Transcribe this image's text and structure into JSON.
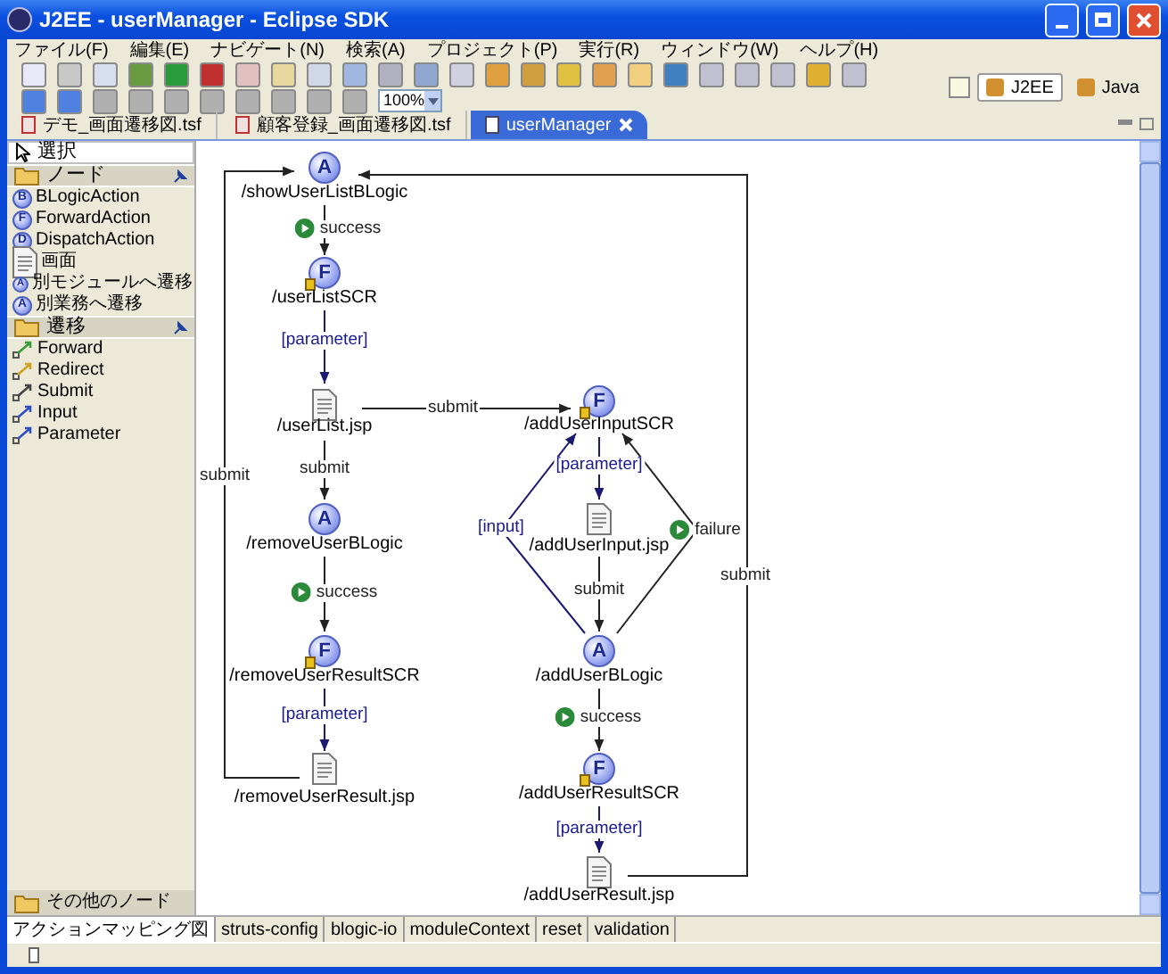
{
  "window": {
    "title": "J2EE - userManager - Eclipse SDK"
  },
  "menu": [
    "ファイル(F)",
    "編集(E)",
    "ナビゲート(N)",
    "検索(A)",
    "プロジェクト(P)",
    "実行(R)",
    "ウィンドウ(W)",
    "ヘルプ(H)"
  ],
  "toolbar": {
    "zoom": "100%"
  },
  "perspectives": [
    {
      "label": "J2EE",
      "selected": true
    },
    {
      "label": "Java",
      "selected": false
    }
  ],
  "editor_tabs": [
    {
      "label": "デモ_画面遷移図.tsf",
      "selected": false
    },
    {
      "label": "顧客登録_画面遷移図.tsf",
      "selected": false
    },
    {
      "label": "userManager",
      "selected": true
    }
  ],
  "palette": {
    "select": {
      "label": "選択",
      "selected": true
    },
    "sections": [
      {
        "title": "ノード",
        "items": [
          {
            "label": "BLogicAction",
            "kind": "circle",
            "badge": "B"
          },
          {
            "label": "ForwardAction",
            "kind": "circle",
            "badge": "F"
          },
          {
            "label": "DispatchAction",
            "kind": "circle",
            "badge": "D"
          },
          {
            "label": "画面",
            "kind": "page"
          },
          {
            "label": "別モジュールへ遷移",
            "kind": "small-circle",
            "badge": "A"
          },
          {
            "label": "別業務へ遷移",
            "kind": "circle",
            "badge": "A"
          }
        ]
      },
      {
        "title": "遷移",
        "items": [
          {
            "label": "Forward",
            "kind": "forward"
          },
          {
            "label": "Redirect",
            "kind": "redirect"
          },
          {
            "label": "Submit",
            "kind": "submit"
          },
          {
            "label": "Input",
            "kind": "input"
          },
          {
            "label": "Parameter",
            "kind": "parameter"
          }
        ]
      }
    ],
    "footer": "その他のノード"
  },
  "diagram": {
    "nodes": [
      {
        "name": "/showUserListBLogic",
        "kind": "action",
        "badge": "A"
      },
      {
        "name": "/userListSCR",
        "kind": "forward",
        "badge": "F"
      },
      {
        "name": "/userList.jsp",
        "kind": "jsp"
      },
      {
        "name": "/removeUserBLogic",
        "kind": "action",
        "badge": "A"
      },
      {
        "name": "/removeUserResultSCR",
        "kind": "forward",
        "badge": "F"
      },
      {
        "name": "/removeUserResult.jsp",
        "kind": "jsp"
      },
      {
        "name": "/addUserInputSCR",
        "kind": "forward",
        "badge": "F"
      },
      {
        "name": "/addUserInput.jsp",
        "kind": "jsp"
      },
      {
        "name": "/addUserBLogic",
        "kind": "action",
        "badge": "A"
      },
      {
        "name": "/addUserResultSCR",
        "kind": "forward",
        "badge": "F"
      },
      {
        "name": "/addUserResult.jsp",
        "kind": "jsp"
      }
    ],
    "edges": [
      {
        "label": "success",
        "kind": "forward"
      },
      {
        "label": "[parameter]",
        "kind": "param"
      },
      {
        "label": "submit",
        "kind": "plain"
      },
      {
        "label": "submit",
        "kind": "plain"
      },
      {
        "label": "success",
        "kind": "forward"
      },
      {
        "label": "[parameter]",
        "kind": "param"
      },
      {
        "label": "submit",
        "kind": "plain"
      },
      {
        "label": "[parameter]",
        "kind": "param"
      },
      {
        "label": "[input]",
        "kind": "param"
      },
      {
        "label": "failure",
        "kind": "forward"
      },
      {
        "label": "submit",
        "kind": "plain"
      },
      {
        "label": "success",
        "kind": "forward"
      },
      {
        "label": "[parameter]",
        "kind": "param"
      },
      {
        "label": "submit",
        "kind": "plain"
      }
    ]
  },
  "bottom_tabs": [
    {
      "label": "アクションマッピング図",
      "selected": true
    },
    {
      "label": "struts-config",
      "selected": false
    },
    {
      "label": "blogic-io",
      "selected": false
    },
    {
      "label": "moduleContext",
      "selected": false
    },
    {
      "label": "reset",
      "selected": false
    },
    {
      "label": "validation",
      "selected": false
    }
  ]
}
